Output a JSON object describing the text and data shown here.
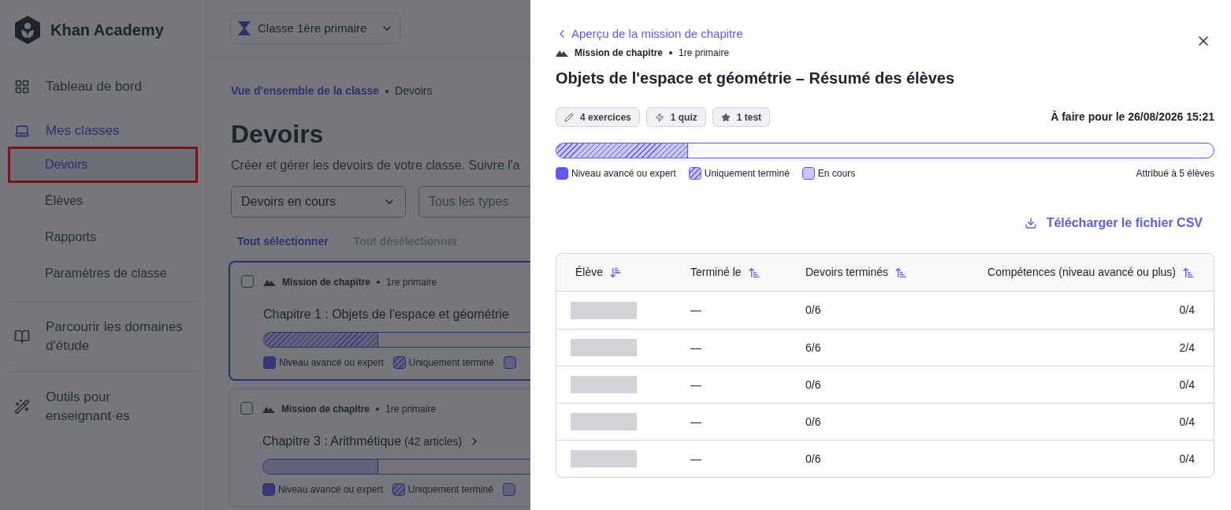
{
  "sidebar": {
    "brand": "Khan Academy",
    "items": [
      {
        "label": "Tableau de bord",
        "selected": false
      },
      {
        "label": "Mes classes",
        "selected": true,
        "children": [
          {
            "label": "Devoirs",
            "selected": true,
            "highlighted": true
          },
          {
            "label": "Élèves",
            "selected": false,
            "highlighted": false
          },
          {
            "label": "Rapports",
            "selected": false,
            "highlighted": false
          },
          {
            "label": "Paramètres de classe",
            "selected": false,
            "highlighted": false
          }
        ]
      },
      {
        "label": "Parcourir les domaines d'étude",
        "selected": false
      },
      {
        "label": "Outils pour enseignant·es",
        "selected": false
      }
    ]
  },
  "main": {
    "class_selector": "Classe 1ère primaire",
    "breadcrumb": {
      "link": "Vue d'ensemble de la classe",
      "current": "Devoirs"
    },
    "title": "Devoirs",
    "description": "Créer et gérer les devoirs de votre classe. Suivre l'a",
    "filters": [
      {
        "value": "Devoirs en cours",
        "kind": "dropdown"
      },
      {
        "placeholder": "Tous les types",
        "kind": "field"
      }
    ],
    "actions": [
      {
        "label": "Tout sélectionner",
        "disabled": false
      },
      {
        "label": "Tout désélectionner",
        "disabled": true
      }
    ],
    "cards": [
      {
        "checked": false,
        "selected": true,
        "type": "Mission de chapitre",
        "grade": "1re primaire",
        "title": "Chapitre 1 : Objets de l'espace et géométrie",
        "level": 0.39,
        "kind": "hatched",
        "legend": [
          "Niveau avancé ou expert",
          "Uniquement terminé"
        ]
      },
      {
        "checked": false,
        "selected": false,
        "type": "Mission de chapitre",
        "grade": "1re primaire",
        "title": "Chapitre 3 : Arithmétique",
        "count": "(42 articles)",
        "level": 0.39,
        "kind": "light",
        "legend": [
          "Niveau avancé ou expert",
          "Uniquement terminé"
        ]
      }
    ]
  },
  "panel": {
    "back_link": "Aperçu de la mission de chapitre",
    "type": "Mission de chapitre",
    "grade": "1re primaire",
    "title": "Objets de l'espace et géométrie – Résumé des élèves",
    "chips": [
      {
        "label": "4 exercices"
      },
      {
        "label": "1 quiz"
      },
      {
        "label": "1 test"
      }
    ],
    "due": "À faire pour le 26/08/2026 15:21",
    "progress": {
      "level": 0.2,
      "kind": "hatched"
    },
    "legend": [
      {
        "label": "Niveau avancé ou expert",
        "kind": "solid"
      },
      {
        "label": "Uniquement terminé",
        "kind": "hatched"
      },
      {
        "label": "En cours",
        "kind": "light"
      }
    ],
    "assigned": "Attribué à 5 élèves",
    "download": "Télécharger le fichier CSV",
    "table": {
      "columns": [
        {
          "label": "Élève",
          "kind": "descending"
        },
        {
          "label": "Terminé le",
          "kind": "ascending"
        },
        {
          "label": "Devoirs terminés",
          "kind": "ascending"
        },
        {
          "label": "Compétences (niveau avancé ou plus)",
          "kind": "ascending"
        }
      ],
      "rows": [
        {
          "kind": "redacted",
          "finished": "—",
          "done": "0/6",
          "skills": "0/4"
        },
        {
          "kind": "redacted",
          "finished": "—",
          "done": "6/6",
          "skills": "2/4"
        },
        {
          "kind": "redacted",
          "finished": "—",
          "done": "0/6",
          "skills": "0/4"
        },
        {
          "kind": "redacted",
          "finished": "—",
          "done": "0/6",
          "skills": "0/4"
        },
        {
          "kind": "redacted",
          "finished": "—",
          "done": "0/6",
          "skills": "0/4"
        }
      ]
    }
  }
}
